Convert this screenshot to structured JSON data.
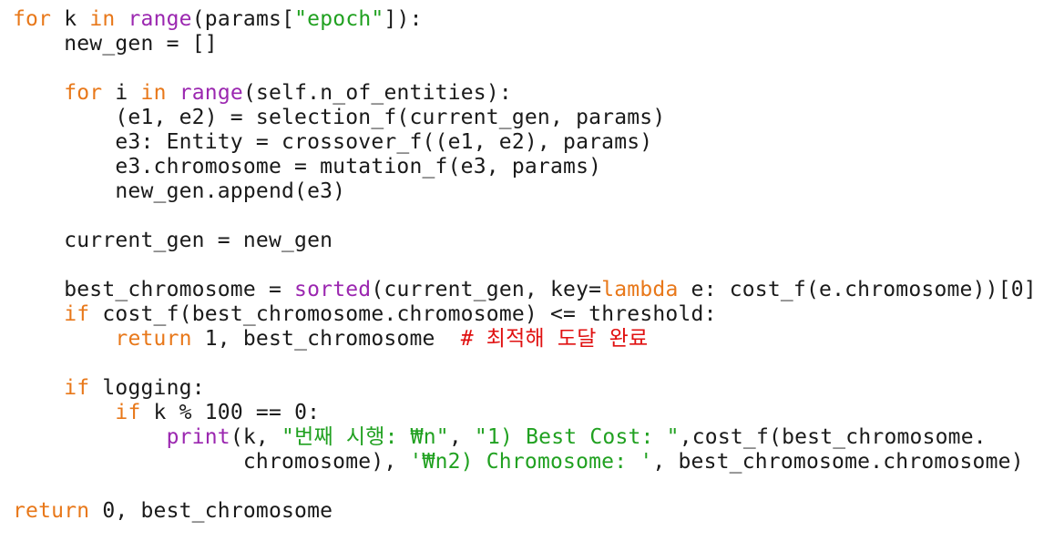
{
  "code_lines": [
    [
      {
        "c": "kw",
        "t": "for"
      },
      {
        "c": "pl",
        "t": " k "
      },
      {
        "c": "kw",
        "t": "in"
      },
      {
        "c": "pl",
        "t": " "
      },
      {
        "c": "bi",
        "t": "range"
      },
      {
        "c": "pl",
        "t": "(params["
      },
      {
        "c": "str",
        "t": "\"epoch\""
      },
      {
        "c": "pl",
        "t": "]):"
      }
    ],
    [
      {
        "c": "pl",
        "t": "    new_gen = []"
      }
    ],
    [],
    [
      {
        "c": "pl",
        "t": "    "
      },
      {
        "c": "kw",
        "t": "for"
      },
      {
        "c": "pl",
        "t": " i "
      },
      {
        "c": "kw",
        "t": "in"
      },
      {
        "c": "pl",
        "t": " "
      },
      {
        "c": "bi",
        "t": "range"
      },
      {
        "c": "pl",
        "t": "(self.n_of_entities):"
      }
    ],
    [
      {
        "c": "pl",
        "t": "        (e1, e2) = selection_f(current_gen, params)"
      }
    ],
    [
      {
        "c": "pl",
        "t": "        e3: Entity = crossover_f((e1, e2), params)"
      }
    ],
    [
      {
        "c": "pl",
        "t": "        e3.chromosome = mutation_f(e3, params)"
      }
    ],
    [
      {
        "c": "pl",
        "t": "        new_gen.append(e3)"
      }
    ],
    [],
    [
      {
        "c": "pl",
        "t": "    current_gen = new_gen"
      }
    ],
    [],
    [
      {
        "c": "pl",
        "t": "    best_chromosome = "
      },
      {
        "c": "bi",
        "t": "sorted"
      },
      {
        "c": "pl",
        "t": "(current_gen, key="
      },
      {
        "c": "kw",
        "t": "lambda"
      },
      {
        "c": "pl",
        "t": " e: cost_f(e.chromosome))[0]"
      }
    ],
    [
      {
        "c": "pl",
        "t": "    "
      },
      {
        "c": "kw",
        "t": "if"
      },
      {
        "c": "pl",
        "t": " cost_f(best_chromosome.chromosome) <= threshold:"
      }
    ],
    [
      {
        "c": "pl",
        "t": "        "
      },
      {
        "c": "kw",
        "t": "return"
      },
      {
        "c": "pl",
        "t": " 1, best_chromosome  "
      },
      {
        "c": "cm",
        "t": "# 최적해 도달 완료"
      }
    ],
    [],
    [
      {
        "c": "pl",
        "t": "    "
      },
      {
        "c": "kw",
        "t": "if"
      },
      {
        "c": "pl",
        "t": " logging:"
      }
    ],
    [
      {
        "c": "pl",
        "t": "        "
      },
      {
        "c": "kw",
        "t": "if"
      },
      {
        "c": "pl",
        "t": " k % 100 == 0:"
      }
    ],
    [
      {
        "c": "pl",
        "t": "            "
      },
      {
        "c": "bi",
        "t": "print"
      },
      {
        "c": "pl",
        "t": "(k, "
      },
      {
        "c": "str",
        "t": "\"번째 시행: ₩n\""
      },
      {
        "c": "pl",
        "t": ", "
      },
      {
        "c": "str",
        "t": "\"1) Best Cost: \""
      },
      {
        "c": "pl",
        "t": ",cost_f(best_chromosome."
      }
    ],
    [
      {
        "c": "pl",
        "t": "                  chromosome), "
      },
      {
        "c": "str",
        "t": "'₩n2) Chromosome: '"
      },
      {
        "c": "pl",
        "t": ", best_chromosome.chromosome)"
      }
    ],
    [],
    [
      {
        "c": "kw",
        "t": "return"
      },
      {
        "c": "pl",
        "t": " 0, best_chromosome"
      }
    ]
  ],
  "colors": {
    "keyword": "#e8781a",
    "builtin": "#9b27b0",
    "string": "#21a121",
    "comment": "#e01010",
    "text": "#1a1a1a",
    "background": "#ffffff"
  }
}
